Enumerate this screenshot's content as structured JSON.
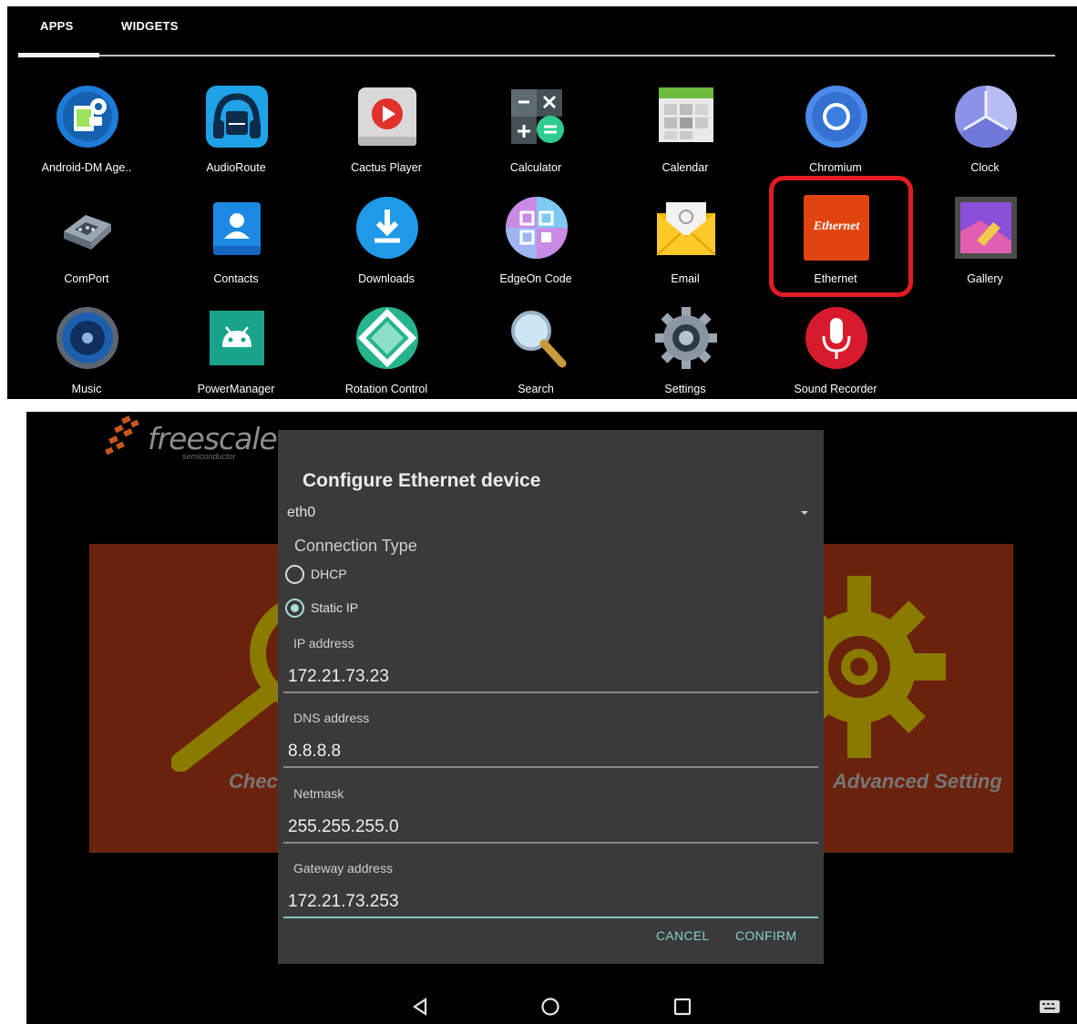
{
  "drawer": {
    "tabs": [
      "APPS",
      "WIDGETS"
    ],
    "apps": [
      {
        "label": "Android-DM Age..",
        "icon": "android-dm-agent-icon"
      },
      {
        "label": "AudioRoute",
        "icon": "audioroute-icon"
      },
      {
        "label": "Cactus Player",
        "icon": "cactus-player-icon"
      },
      {
        "label": "Calculator",
        "icon": "calculator-icon"
      },
      {
        "label": "Calendar",
        "icon": "calendar-icon"
      },
      {
        "label": "Chromium",
        "icon": "chromium-icon"
      },
      {
        "label": "Clock",
        "icon": "clock-icon"
      },
      {
        "label": "ComPort",
        "icon": "comport-icon"
      },
      {
        "label": "Contacts",
        "icon": "contacts-icon"
      },
      {
        "label": "Downloads",
        "icon": "downloads-icon"
      },
      {
        "label": "EdgeOn Code",
        "icon": "edgeon-code-icon"
      },
      {
        "label": "Email",
        "icon": "email-icon"
      },
      {
        "label": "Ethernet",
        "icon": "ethernet-icon",
        "icon_text": "Ethernet"
      },
      {
        "label": "Gallery",
        "icon": "gallery-icon"
      },
      {
        "label": "Music",
        "icon": "music-icon"
      },
      {
        "label": "PowerManager",
        "icon": "powermanager-icon"
      },
      {
        "label": "Rotation Control",
        "icon": "rotation-control-icon"
      },
      {
        "label": "Search",
        "icon": "search-icon"
      },
      {
        "label": "Settings",
        "icon": "settings-icon"
      },
      {
        "label": "Sound Recorder",
        "icon": "sound-recorder-icon"
      }
    ],
    "highlight_color": "#e31b23"
  },
  "background": {
    "brand": "freescale",
    "brand_sub": "semiconductor",
    "left_label": "Check",
    "right_label": "Advanced Setting"
  },
  "dialog": {
    "title": "Configure Ethernet device",
    "interface": "eth0",
    "connection_type_label": "Connection Type",
    "options": [
      "DHCP",
      "Static IP"
    ],
    "selected_option": "Static IP",
    "fields": [
      {
        "label": "IP address",
        "value": "172.21.73.23"
      },
      {
        "label": "DNS address",
        "value": "8.8.8.8"
      },
      {
        "label": "Netmask",
        "value": "255.255.255.0"
      },
      {
        "label": "Gateway address",
        "value": "172.21.73.253"
      }
    ],
    "cancel": "CANCEL",
    "confirm": "CONFIRM",
    "accent_color": "#86cfc7"
  },
  "navbar": {
    "buttons": [
      "back-icon",
      "home-icon",
      "recents-icon",
      "keyboard-icon"
    ]
  }
}
